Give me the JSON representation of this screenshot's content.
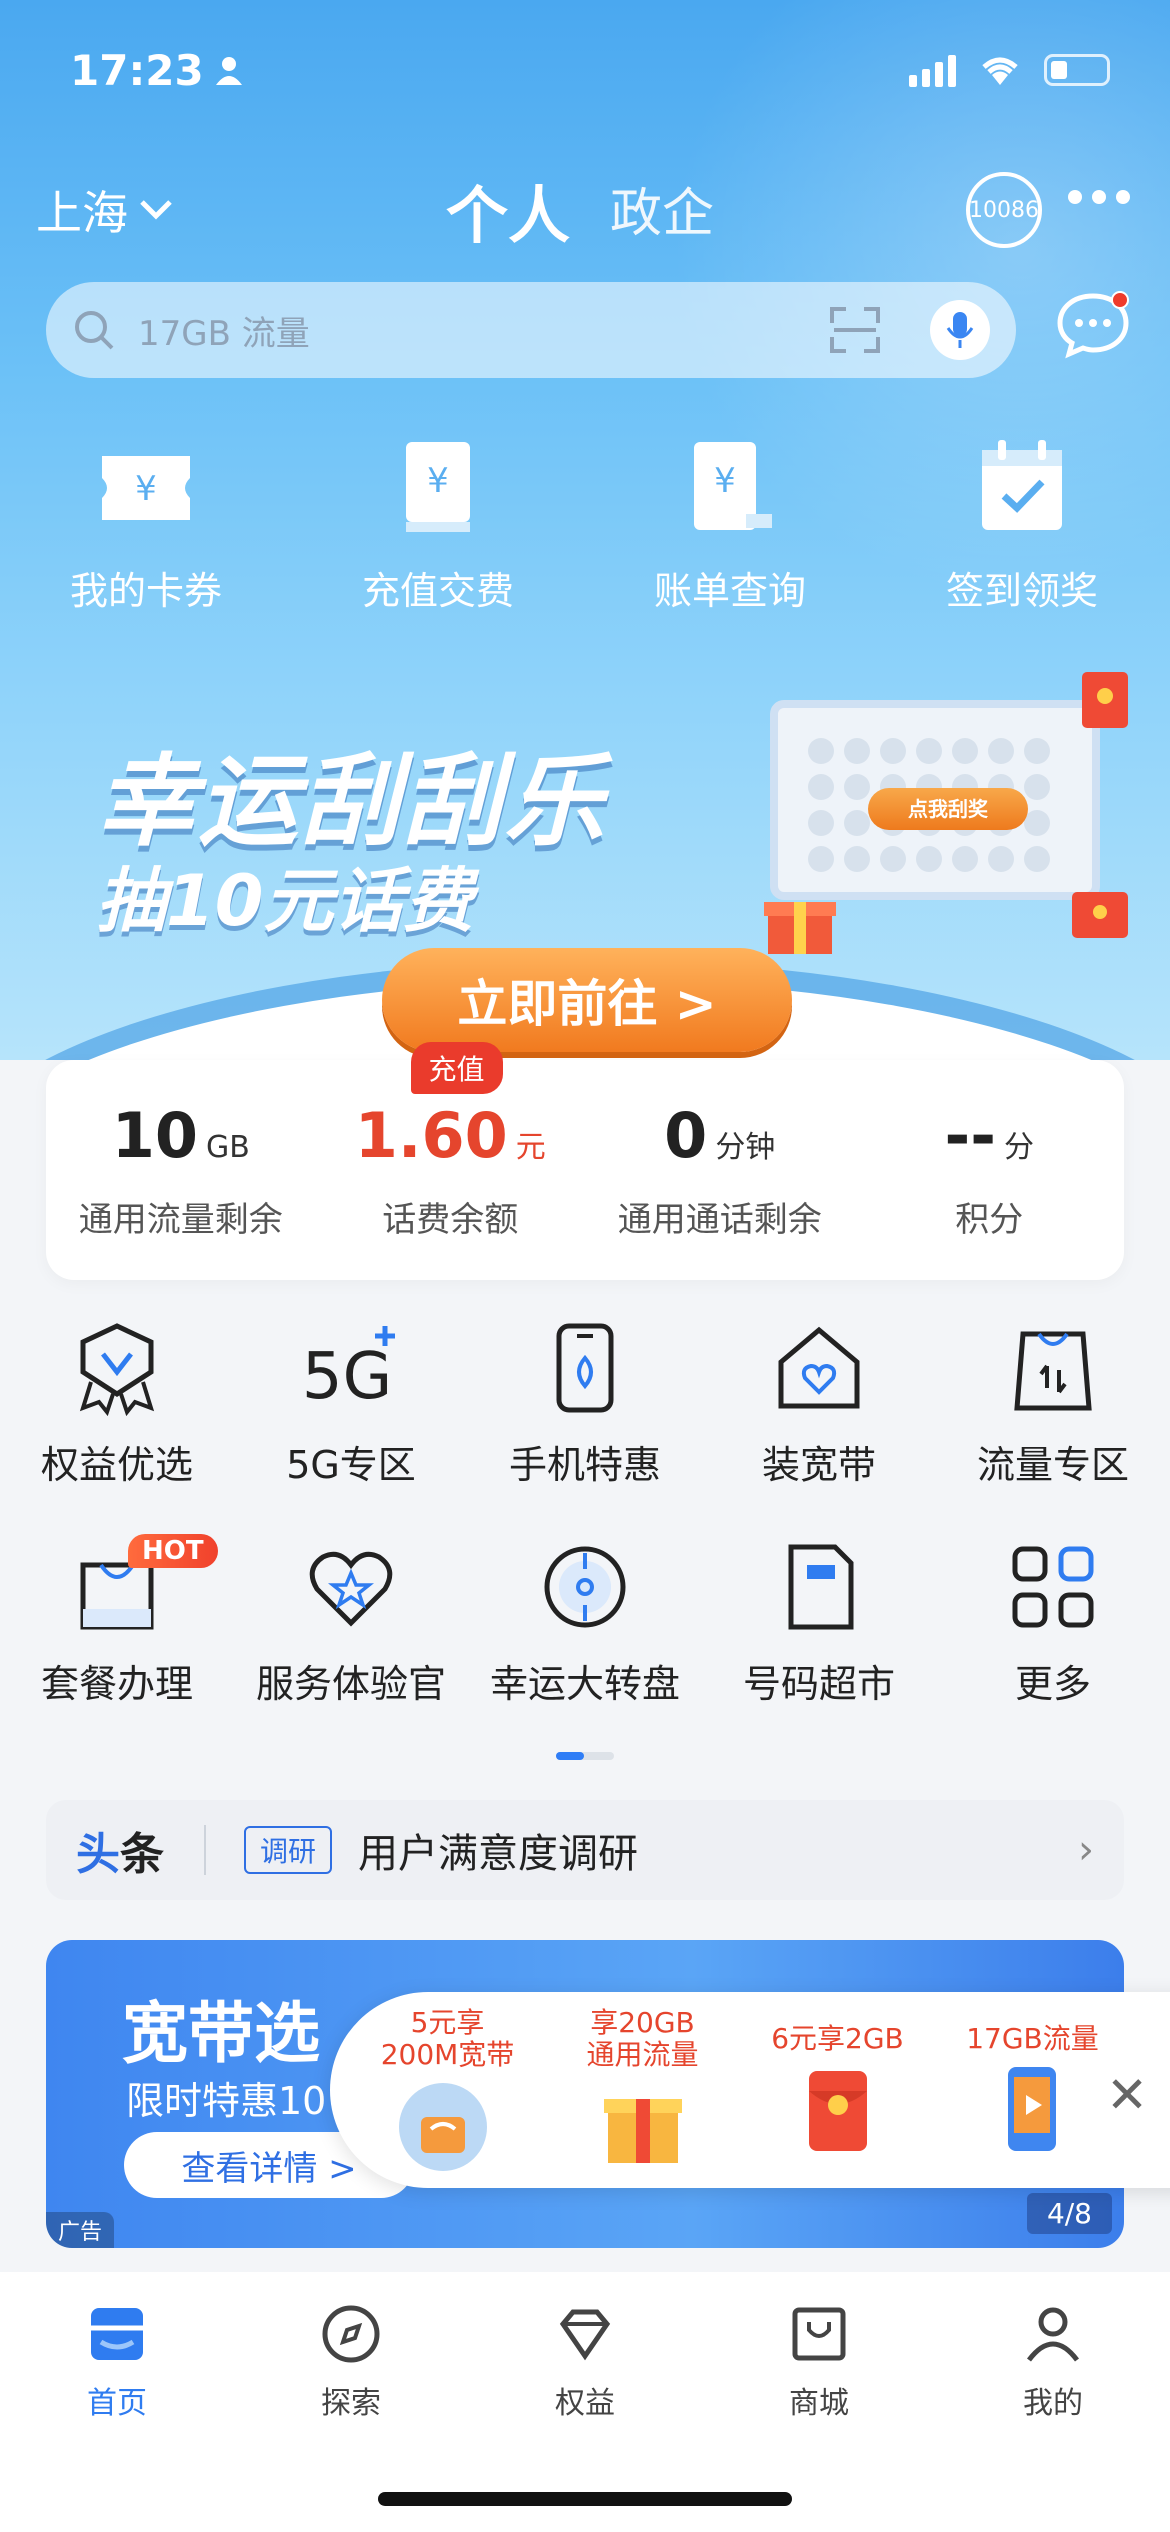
{
  "status": {
    "time": "17:23"
  },
  "header": {
    "city": "上海",
    "tab_personal": "个人",
    "tab_gov": "政企",
    "hotline": "10086"
  },
  "search": {
    "placeholder": "17GB 流量"
  },
  "quick_actions": [
    {
      "label": "我的卡券",
      "icon": "coupon-icon"
    },
    {
      "label": "充值交费",
      "icon": "recharge-icon"
    },
    {
      "label": "账单查询",
      "icon": "bill-icon"
    },
    {
      "label": "签到领奖",
      "icon": "calendar-check-icon"
    }
  ],
  "banner": {
    "title": "幸运刮刮乐",
    "subtitle": "抽10元话费",
    "scratch_btn": "点我刮奖",
    "cta": "立即前往 >"
  },
  "balance": {
    "recharge_tag": "充值",
    "items": [
      {
        "value": "10",
        "unit": "GB",
        "label": "通用流量剩余"
      },
      {
        "value": "1.60",
        "unit": "元",
        "label": "话费余额"
      },
      {
        "value": "0",
        "unit": "分钟",
        "label": "通用通话剩余"
      },
      {
        "value": "--",
        "unit": "分",
        "label": "积分"
      }
    ]
  },
  "services": [
    {
      "label": "权益优选",
      "icon": "badge-icon"
    },
    {
      "label": "5G专区",
      "icon": "5g-icon"
    },
    {
      "label": "手机特惠",
      "icon": "phone-icon"
    },
    {
      "label": "装宽带",
      "icon": "house-icon"
    },
    {
      "label": "流量专区",
      "icon": "bag-icon"
    },
    {
      "label": "套餐办理",
      "icon": "shopping-bag-icon",
      "badge": "HOT"
    },
    {
      "label": "服务体验官",
      "icon": "heart-star-icon"
    },
    {
      "label": "幸运大转盘",
      "icon": "wheel-icon"
    },
    {
      "label": "号码超市",
      "icon": "sim-card-icon"
    },
    {
      "label": "更多",
      "icon": "grid-icon"
    }
  ],
  "headline": {
    "title_a": "头",
    "title_b": "条",
    "tag": "调研",
    "text": "用户满意度调研"
  },
  "ad": {
    "title": "宽带选",
    "subtitle": "限时特惠10",
    "button": "查看详情 >",
    "label": "广告",
    "page": "4/8"
  },
  "promo": [
    {
      "line1": "5元享",
      "line2": "200M宽带"
    },
    {
      "line1": "享20GB",
      "line2": "通用流量"
    },
    {
      "line1": "6元享2GB",
      "line2": ""
    },
    {
      "line1": "17GB流量",
      "line2": ""
    }
  ],
  "bottom_nav": [
    {
      "label": "首页",
      "icon": "home-icon",
      "active": true
    },
    {
      "label": "探索",
      "icon": "compass-icon"
    },
    {
      "label": "权益",
      "icon": "diamond-icon"
    },
    {
      "label": "商城",
      "icon": "shop-icon"
    },
    {
      "label": "我的",
      "icon": "user-icon"
    }
  ],
  "colors": {
    "primary": "#2f7cf0",
    "accent_red": "#e5452d",
    "orange": "#f17a1f"
  }
}
